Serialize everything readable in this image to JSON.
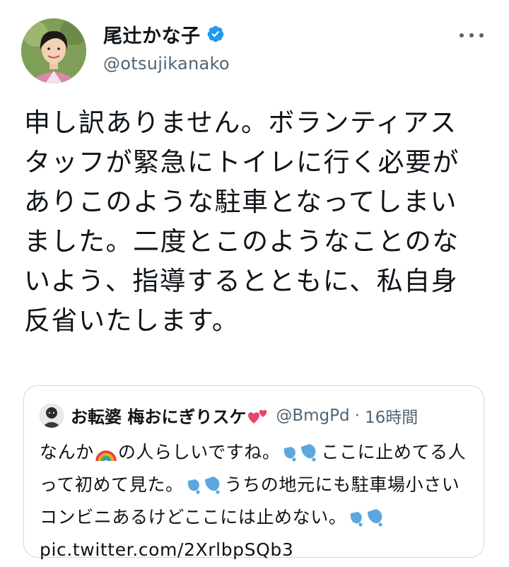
{
  "author": {
    "display_name": "尾辻かな子",
    "handle": "@otsujikanako",
    "verified_icon": "verified-badge-icon",
    "accent_color": "#1d9bf0"
  },
  "more_icon": "more-horizontal-icon",
  "tweet_text": "申し訳ありません。ボランティアスタッフが緊急にトイレに行く必要がありこのような駐車となってしまいました。二度とこのようなことのないよう、指導するとともに、私自身反省いたします。",
  "quote": {
    "display_name": "お転婆 梅おにぎりスケ",
    "name_emoji": "two-hearts-icon",
    "handle": "@BmgPd",
    "separator": "·",
    "time": "16時間",
    "body": {
      "part1": "なんか",
      "part1_emoji": "rainbow-icon",
      "part2": "の人らしいですね。",
      "part2_emoji": "sweat-droplets-icon",
      "part3": "ここに止めてる人って初めて見た。",
      "part3_emoji": "sweat-droplets-icon",
      "part4": "うちの地元にも駐車場小さいコンビニあるけどここには止めない。",
      "part4_emoji": "sweat-droplets-icon",
      "link": "pic.twitter.com/2XrlbpSQb3"
    }
  }
}
